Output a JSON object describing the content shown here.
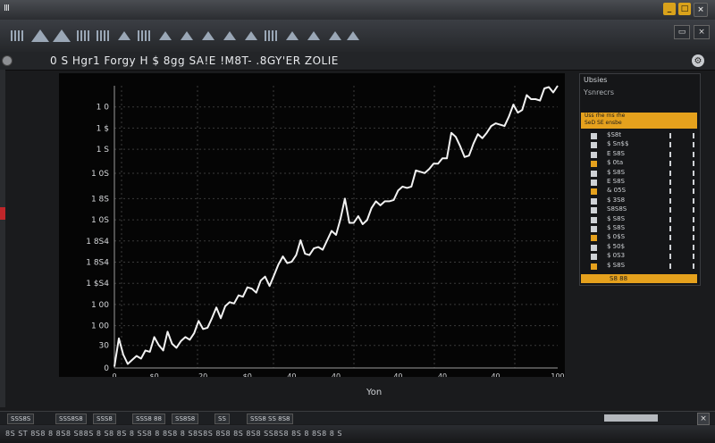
{
  "window": {
    "title": "Ⅲ",
    "controls": [
      "_",
      "□",
      "×"
    ]
  },
  "toolbar": {
    "right_controls": [
      "▭",
      "×"
    ]
  },
  "header": {
    "chart_title": "0 S Hgr1 Forgy H $ 8gg SA!E !M8T- .8GY'ER ZOLIE"
  },
  "colors": {
    "accent": "#e5a11d",
    "alert": "#c0262a",
    "line": "#f2f2f2",
    "background": "#050505"
  },
  "chart_data": {
    "type": "line",
    "x_label": "Yon",
    "ylim": [
      0,
      1000
    ],
    "y_ticks": [
      {
        "v": 0,
        "label": "0"
      },
      {
        "v": 80,
        "label": "30"
      },
      {
        "v": 150,
        "label": "1 00"
      },
      {
        "v": 225,
        "label": "1 00"
      },
      {
        "v": 300,
        "label": "1 $S4"
      },
      {
        "v": 375,
        "label": "1 8S4"
      },
      {
        "v": 450,
        "label": "1 8S4"
      },
      {
        "v": 525,
        "label": "1 0S"
      },
      {
        "v": 600,
        "label": "1 8S"
      },
      {
        "v": 690,
        "label": "1 0S"
      },
      {
        "v": 775,
        "label": "1 S"
      },
      {
        "v": 850,
        "label": "1 $"
      },
      {
        "v": 925,
        "label": "1 0"
      }
    ],
    "x_ticks": [
      {
        "v": 0,
        "label": "0"
      },
      {
        "v": 9,
        "label": "$0"
      },
      {
        "v": 20,
        "label": "20"
      },
      {
        "v": 30,
        "label": "$0"
      },
      {
        "v": 40,
        "label": "40"
      },
      {
        "v": 50,
        "label": "40"
      },
      {
        "v": 64,
        "label": "40"
      },
      {
        "v": 74,
        "label": "40"
      },
      {
        "v": 86,
        "label": "40"
      },
      {
        "v": 100,
        "label": "100"
      }
    ],
    "x": [
      0,
      1,
      2,
      3,
      4,
      5,
      6,
      7,
      8,
      9,
      10,
      11,
      12,
      13,
      14,
      15,
      16,
      17,
      18,
      19,
      20,
      21,
      22,
      23,
      24,
      25,
      26,
      27,
      28,
      29,
      30,
      31,
      32,
      33,
      34,
      35,
      36,
      37,
      38,
      39,
      40,
      41,
      42,
      43,
      44,
      45,
      46,
      47,
      48,
      49,
      50,
      51,
      52,
      53,
      54,
      55,
      56,
      57,
      58,
      59,
      60,
      61,
      62,
      63,
      64,
      65,
      66,
      67,
      68,
      69,
      70,
      71,
      72,
      73,
      74,
      75,
      76,
      77,
      78,
      79,
      80,
      81,
      82,
      83,
      84,
      85,
      86,
      87,
      88,
      89,
      90,
      91,
      92,
      93,
      94,
      95,
      96,
      97,
      98,
      99,
      100
    ],
    "y": [
      10,
      220,
      100,
      30,
      60,
      90,
      70,
      130,
      120,
      230,
      170,
      130,
      270,
      180,
      150,
      200,
      230,
      210,
      260,
      350,
      290,
      300,
      370,
      450,
      370,
      460,
      490,
      480,
      540,
      530,
      600,
      590,
      560,
      650,
      680,
      610,
      690,
      770,
      830,
      780,
      790,
      840,
      950,
      850,
      840,
      890,
      900,
      880,
      950,
      1020,
      990,
      1110,
      1260,
      1080,
      1080,
      1130,
      1070,
      1100,
      1190,
      1240,
      1210,
      1240,
      1240,
      1250,
      1320,
      1350,
      1340,
      1350,
      1470,
      1460,
      1450,
      1480,
      1520,
      1520,
      1560,
      1560,
      1750,
      1720,
      1650,
      1570,
      1580,
      1670,
      1740,
      1710,
      1750,
      1800,
      1820,
      1810,
      1800,
      1870,
      1960,
      1900,
      1920,
      2030,
      2000,
      2000,
      1990,
      2080,
      2090,
      2050,
      2100
    ]
  },
  "watchlist": {
    "title": "Ubsies",
    "subtitle": "Ysnrecrs",
    "header_row": "Uss rhe rns rhe\nSeD SE ensbe",
    "rows": [
      {
        "label": "$S8t",
        "color": "white"
      },
      {
        "label": "$ Sn$$",
        "color": "white"
      },
      {
        "label": "E S8S",
        "color": "white"
      },
      {
        "label": "$ 0ta",
        "color": "orange"
      },
      {
        "label": "$ S8S",
        "color": "white"
      },
      {
        "label": "E S8S",
        "color": "white"
      },
      {
        "label": "& 05S",
        "color": "orange"
      },
      {
        "label": "$ 3S8",
        "color": "white"
      },
      {
        "label": "S8S8S",
        "color": "white"
      },
      {
        "label": "$ S8S",
        "color": "white"
      },
      {
        "label": "$ S8S",
        "color": "white"
      },
      {
        "label": "$ 0$S",
        "color": "orange"
      },
      {
        "label": "$ 50$",
        "color": "white"
      },
      {
        "label": "$ 0S3",
        "color": "white"
      },
      {
        "label": "$ S8S",
        "color": "orange"
      }
    ],
    "footer": "S8 88"
  },
  "statusbar": {
    "tabs": [
      "SSS8S",
      "SSS8S8",
      "SSS8",
      "SSS8 88",
      "SS8S8",
      "SS",
      "SSS8 SS 8S8"
    ]
  },
  "bottom": {
    "text": "8S ST 8S8 8 8S8 S88S 8 S8 8S 8 SS8 8 8S8 8 S8S8S 8S8 8S 8S8 SS8S8 8S 8 8S8 8 S"
  }
}
